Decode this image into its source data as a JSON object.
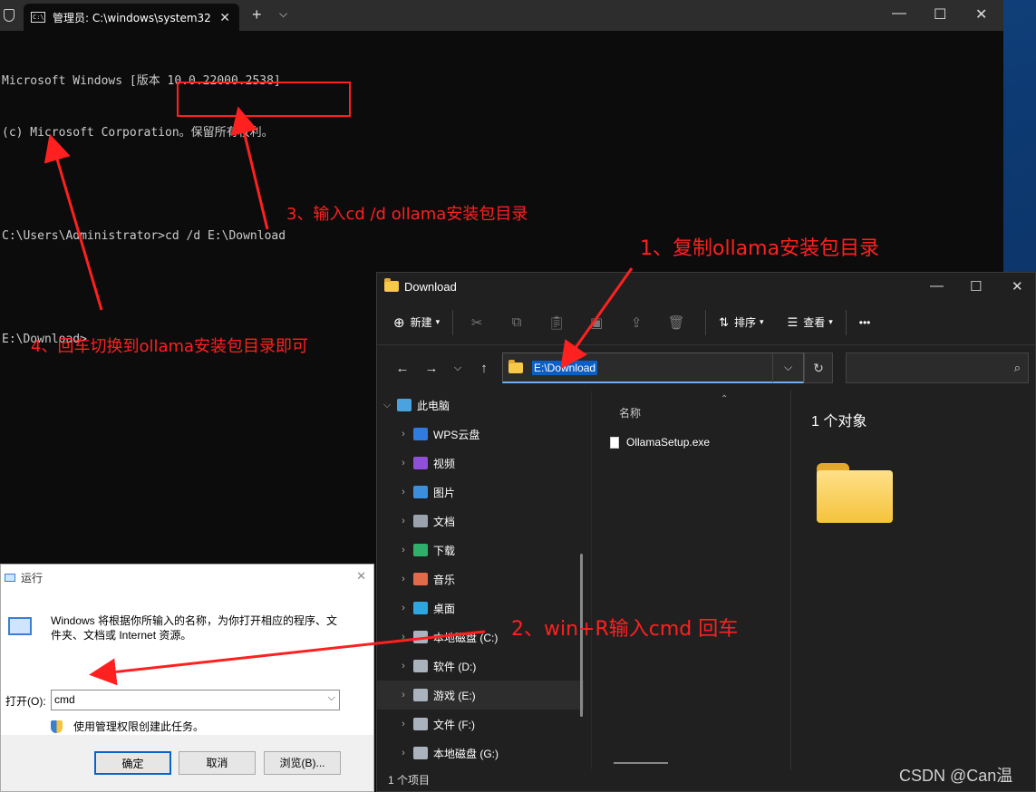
{
  "terminal": {
    "tab_title": "管理员: C:\\windows\\system32",
    "lines": [
      "Microsoft Windows [版本 10.0.22000.2538]",
      "(c) Microsoft Corporation。保留所有权利。",
      "",
      "C:\\Users\\Administrator>cd /d E:\\Download",
      "",
      "E:\\Download>"
    ]
  },
  "explorer": {
    "title": "Download",
    "toolbar": {
      "new_label": "新建",
      "sort_label": "排序",
      "view_label": "查看",
      "more_label": "•••"
    },
    "address": "E:\\Download",
    "search_placeholder": "",
    "nav": [
      {
        "label": "此电脑",
        "icon": "pc-icon",
        "color": "#4aa3df"
      },
      {
        "label": "WPS云盘",
        "icon": "cloud-icon",
        "color": "#2f7be0"
      },
      {
        "label": "视频",
        "icon": "video-icon",
        "color": "#8f4fd8"
      },
      {
        "label": "图片",
        "icon": "pictures-icon",
        "color": "#3b8edc"
      },
      {
        "label": "文档",
        "icon": "documents-icon",
        "color": "#9aa3ad"
      },
      {
        "label": "下载",
        "icon": "download-icon",
        "color": "#2fb06a"
      },
      {
        "label": "音乐",
        "icon": "music-icon",
        "color": "#e06a4a"
      },
      {
        "label": "桌面",
        "icon": "desktop-icon",
        "color": "#2ea6e0"
      },
      {
        "label": "本地磁盘 (C:)",
        "icon": "drive-icon",
        "color": "#aab3bd"
      },
      {
        "label": "软件 (D:)",
        "icon": "drive-icon",
        "color": "#aab3bd"
      },
      {
        "label": "游戏 (E:)",
        "icon": "drive-icon",
        "color": "#aab3bd"
      },
      {
        "label": "文件 (F:)",
        "icon": "drive-icon",
        "color": "#aab3bd"
      },
      {
        "label": "本地磁盘 (G:)",
        "icon": "drive-icon",
        "color": "#aab3bd"
      }
    ],
    "column_name": "名称",
    "files": [
      "OllamaSetup.exe"
    ],
    "preview_count": "1 个对象",
    "status": "1 个项目"
  },
  "run": {
    "title": "运行",
    "description": "Windows 将根据你所输入的名称，为你打开相应的程序、文件夹、文档或 Internet 资源。",
    "open_label": "打开(O):",
    "input_value": "cmd",
    "admin_text": "使用管理权限创建此任务。",
    "ok": "确定",
    "cancel": "取消",
    "browse": "浏览(B)..."
  },
  "annotations": {
    "step1": "1、复制ollama安装包目录",
    "step2": "2、win+R输入cmd 回车",
    "step3": "3、输入cd /d ollama安装包目录",
    "step4": "4、回车切换到ollama安装包目录即可",
    "color": "#ff2020"
  },
  "watermark": "CSDN @Can温"
}
